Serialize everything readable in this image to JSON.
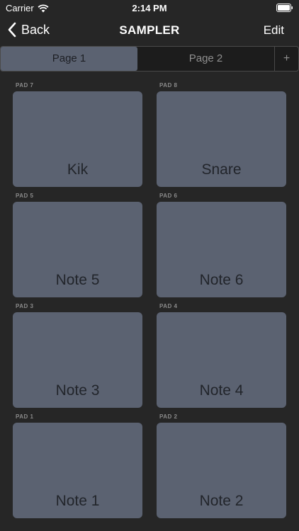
{
  "status_bar": {
    "carrier": "Carrier",
    "time": "2:14 PM"
  },
  "nav": {
    "back_label": "Back",
    "title": "SAMPLER",
    "edit_label": "Edit"
  },
  "segments": {
    "page1": "Page 1",
    "page2": "Page 2",
    "add": "+"
  },
  "pads": [
    {
      "caption": "PAD 7",
      "label": "Kik"
    },
    {
      "caption": "PAD 8",
      "label": "Snare"
    },
    {
      "caption": "PAD 5",
      "label": "Note 5"
    },
    {
      "caption": "PAD 6",
      "label": "Note 6"
    },
    {
      "caption": "PAD 3",
      "label": "Note 3"
    },
    {
      "caption": "PAD 4",
      "label": "Note 4"
    },
    {
      "caption": "PAD 1",
      "label": "Note 1"
    },
    {
      "caption": "PAD 2",
      "label": "Note 2"
    }
  ],
  "colors": {
    "background": "#262626",
    "pad": "#5b6271",
    "pad_text": "#22252b",
    "caption": "#8a8a8a"
  },
  "icons": {
    "wifi": "wifi-icon",
    "battery": "battery-icon",
    "back": "chevron-left-icon"
  }
}
